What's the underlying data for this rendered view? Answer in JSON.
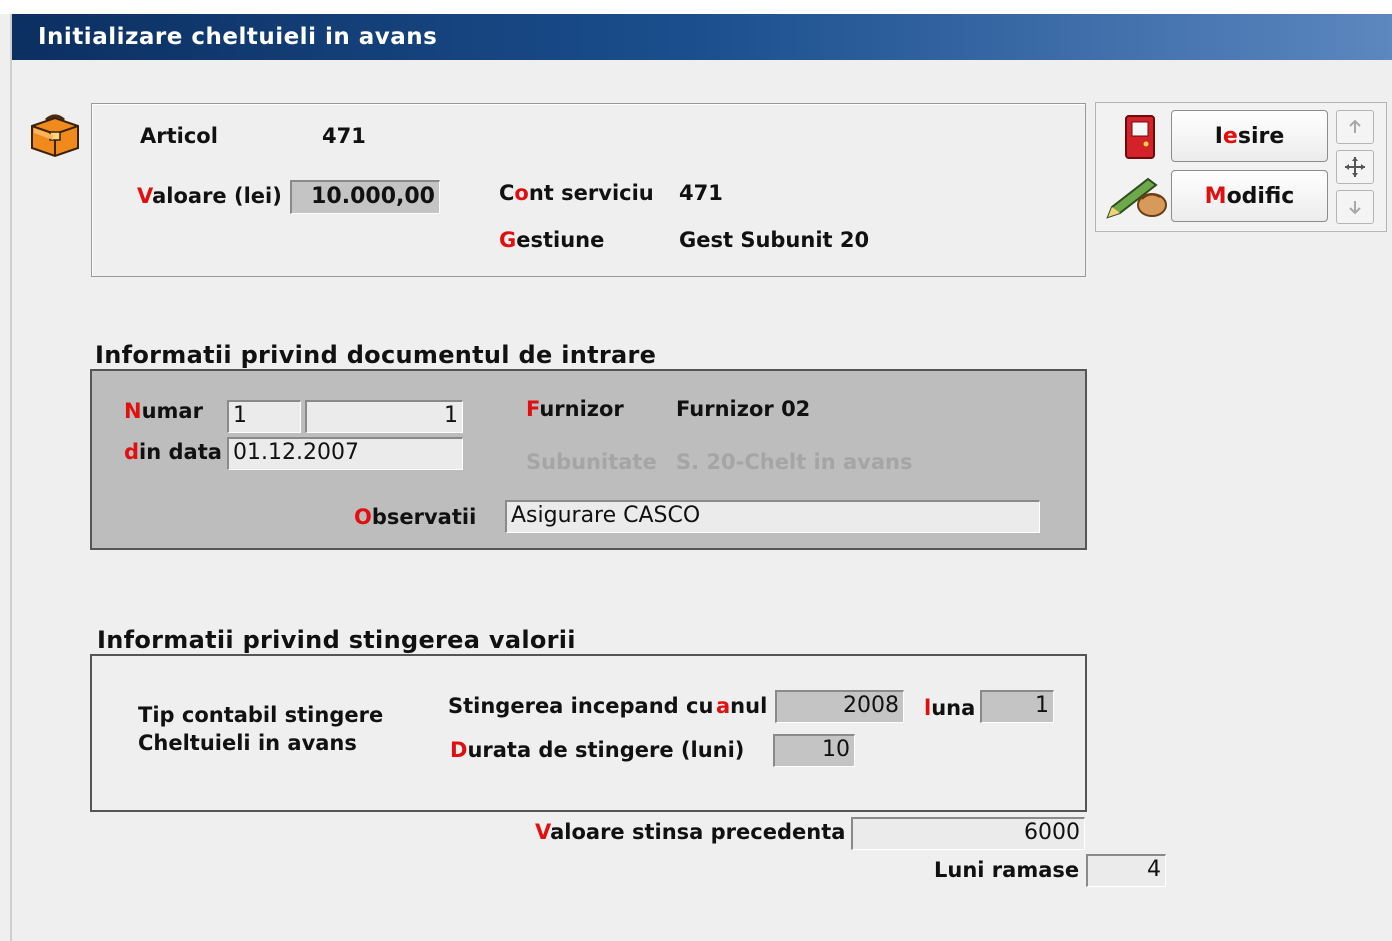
{
  "window": {
    "title": "Initializare cheltuieli in avans"
  },
  "header": {
    "articol_label": "Articol",
    "articol_value": "471",
    "valoare_hotkey": "V",
    "valoare_rest": "aloare (lei)",
    "valoare_value": "10.000,00",
    "cont_hotkey_pre": "C",
    "cont_hotkey": "o",
    "cont_rest": "nt serviciu",
    "cont_value": "471",
    "gestiune_hotkey": "G",
    "gestiune_rest": "estiune",
    "gestiune_value": "Gest Subunit 20"
  },
  "toolbar": {
    "iesire_hotkey_pre": "I",
    "iesire_hotkey": "e",
    "iesire_rest": "sire",
    "modific_hotkey": "M",
    "modific_rest": "odific"
  },
  "doc_section": {
    "title": "Informatii privind documentul de intrare",
    "numar_hotkey": "N",
    "numar_rest": "umar",
    "numar_value1": "1",
    "numar_value2": "1",
    "din_data_hotkey": "d",
    "din_data_rest": "in data",
    "din_data_value": "01.12.2007",
    "furnizor_hotkey": "F",
    "furnizor_rest": "urnizor",
    "furnizor_value": "Furnizor 02",
    "subunitate_label": "Subunitate",
    "subunitate_value": "S. 20-Chelt in avans",
    "observatii_hotkey": "O",
    "observatii_rest": "bservatii",
    "observatii_value": "Asigurare CASCO"
  },
  "stingere_section": {
    "title": "Informatii privind stingerea valorii",
    "tip_line1": "Tip contabil stingere",
    "tip_line2": "Cheltuieli in avans",
    "incepand_label": "Stingerea incepand cu",
    "anul_hotkey": "a",
    "anul_rest": "nul",
    "anul_value": "2008",
    "luna_hotkey": "l",
    "luna_rest": "una",
    "luna_value": "1",
    "durata_hotkey": "D",
    "durata_rest": "urata de stingere (luni)",
    "durata_value": "10"
  },
  "footer": {
    "valoare_stinsa_hotkey": "V",
    "valoare_stinsa_rest": "aloare stinsa precedenta",
    "valoare_stinsa_value": "6000",
    "luni_ramase_label": "Luni ramase",
    "luni_ramase_value": "4"
  },
  "colors": {
    "hotkey": "#e01010",
    "title_bar": "#1b4f8e",
    "disabled": "#a5a5a5"
  },
  "icons": [
    "briefcase-icon",
    "exit-door-icon",
    "edit-pen-icon",
    "arrow-up-icon",
    "move-icon",
    "arrow-down-icon"
  ]
}
